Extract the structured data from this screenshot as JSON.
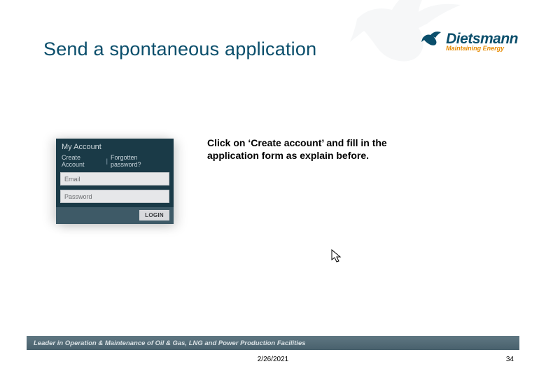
{
  "title": "Send a spontaneous application",
  "logo": {
    "name": "Dietsmann",
    "tagline": "Maintaining Energy"
  },
  "instruction": "Click on ‘Create account’ and fill in the application form as explain before.",
  "login_panel": {
    "header": "My Account",
    "create_link": "Create Account",
    "separator": "|",
    "forgot_link": "Forgotten password?",
    "email_placeholder": "Email",
    "password_placeholder": "Password",
    "login_button": "LOGIN"
  },
  "footer": {
    "tagline": "Leader in Operation & Maintenance of Oil & Gas, LNG and Power Production Facilities",
    "date": "2/26/2021",
    "page": "34"
  }
}
